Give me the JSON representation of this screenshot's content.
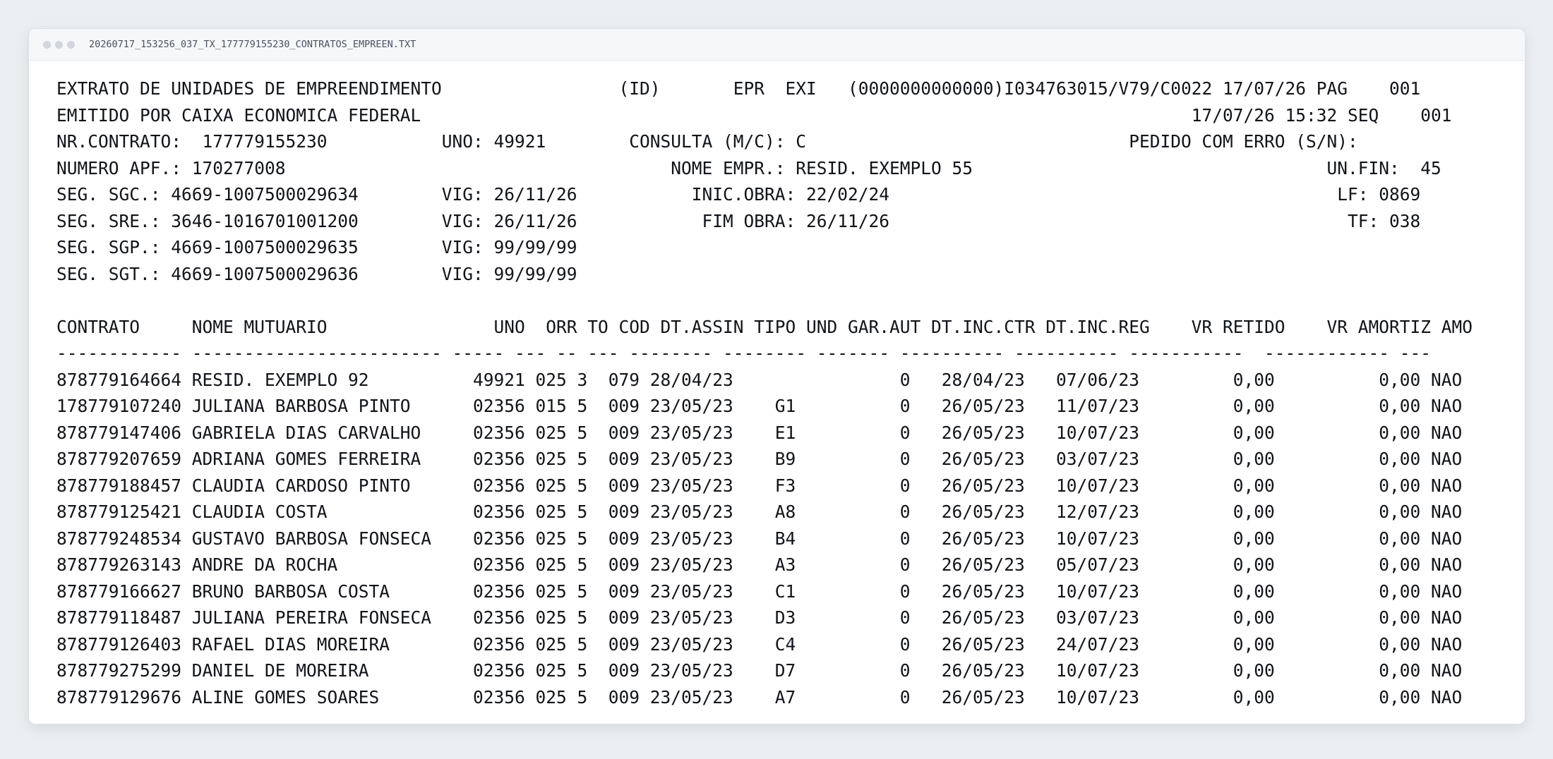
{
  "window": {
    "title": "20260717_153256_037_TX_177779155230_CONTRATOS_EMPREEN.TXT"
  },
  "report": {
    "lines": [
      "EXTRATO DE UNIDADES DE EMPREENDIMENTO                 (ID)       EPR  EXI   (0000000000000)I034763015/V79/C0022 17/07/26 PAG    001",
      "EMITIDO POR CAIXA ECONOMICA FEDERAL                                                                          17/07/26 15:32 SEQ    001",
      "NR.CONTRATO:  177779155230           UNO: 49921        CONSULTA (M/C): C                               PEDIDO COM ERRO (S/N):",
      "NUMERO APF.: 170277008                                     NOME EMPR.: RESID. EXEMPLO 55                                  UN.FIN:  45",
      "SEG. SGC.: 4669-1007500029634        VIG: 26/11/26           INIC.OBRA: 22/02/24                                           LF: 0869",
      "SEG. SRE.: 3646-1016701001200        VIG: 26/11/26            FIM OBRA: 26/11/26                                            TF: 038",
      "SEG. SGP.: 4669-1007500029635        VIG: 99/99/99",
      "SEG. SGT.: 4669-1007500029636        VIG: 99/99/99",
      "",
      "CONTRATO     NOME MUTUARIO                UNO  ORR TO COD DT.ASSIN TIPO UND GAR.AUT DT.INC.CTR DT.INC.REG    VR RETIDO    VR AMORTIZ AMO",
      "------------ ------------------------ ----- --- -- --- -------- -------- ------- ---------- ---------- -----------  ------------ ---",
      "878779164664 RESID. EXEMPLO 92          49921 025 3  079 28/04/23                0   28/04/23   07/06/23         0,00          0,00 NAO",
      "178779107240 JULIANA BARBOSA PINTO      02356 015 5  009 23/05/23    G1          0   26/05/23   11/07/23         0,00          0,00 NAO",
      "878779147406 GABRIELA DIAS CARVALHO     02356 025 5  009 23/05/23    E1          0   26/05/23   10/07/23         0,00          0,00 NAO",
      "878779207659 ADRIANA GOMES FERREIRA     02356 025 5  009 23/05/23    B9          0   26/05/23   03/07/23         0,00          0,00 NAO",
      "878779188457 CLAUDIA CARDOSO PINTO      02356 025 5  009 23/05/23    F3          0   26/05/23   10/07/23         0,00          0,00 NAO",
      "878779125421 CLAUDIA COSTA              02356 025 5  009 23/05/23    A8          0   26/05/23   12/07/23         0,00          0,00 NAO",
      "878779248534 GUSTAVO BARBOSA FONSECA    02356 025 5  009 23/05/23    B4          0   26/05/23   10/07/23         0,00          0,00 NAO",
      "878779263143 ANDRE DA ROCHA             02356 025 5  009 23/05/23    A3          0   26/05/23   05/07/23         0,00          0,00 NAO",
      "878779166627 BRUNO BARBOSA COSTA        02356 025 5  009 23/05/23    C1          0   26/05/23   10/07/23         0,00          0,00 NAO",
      "878779118487 JULIANA PEREIRA FONSECA    02356 025 5  009 23/05/23    D3          0   26/05/23   03/07/23         0,00          0,00 NAO",
      "878779126403 RAFAEL DIAS MOREIRA        02356 025 5  009 23/05/23    C4          0   26/05/23   24/07/23         0,00          0,00 NAO",
      "878779275299 DANIEL DE MOREIRA          02356 025 5  009 23/05/23    D7          0   26/05/23   10/07/23         0,00          0,00 NAO",
      "878779129676 ALINE GOMES SOARES         02356 025 5  009 23/05/23    A7          0   26/05/23   10/07/23         0,00          0,00 NAO"
    ]
  }
}
